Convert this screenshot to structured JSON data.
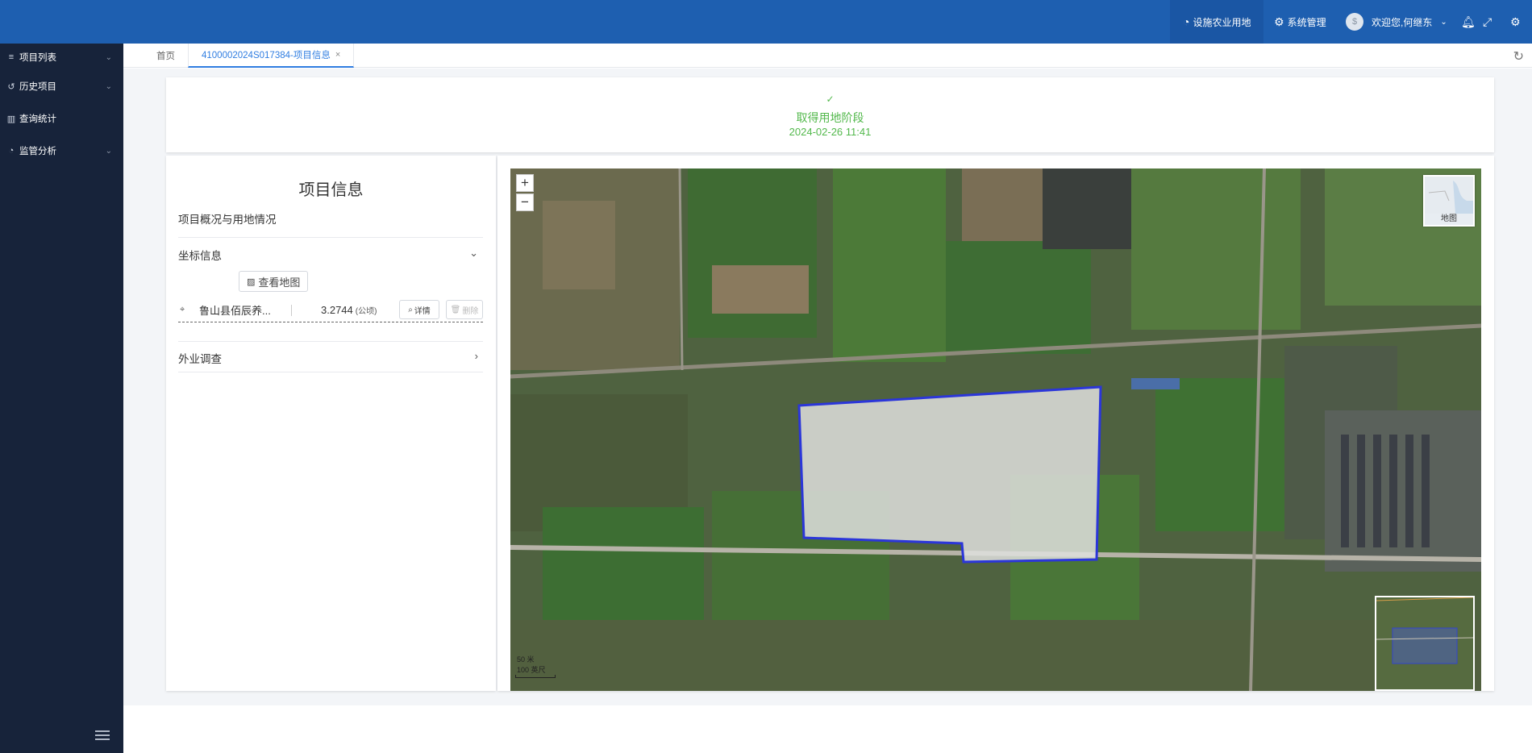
{
  "header": {
    "active_module": "设施农业用地",
    "system_menu": "系统管理",
    "welcome": "欢迎您,何继东",
    "avatar_text": "$"
  },
  "sidebar": {
    "items": [
      {
        "label": "项目列表",
        "icon": "list-icon",
        "expandable": true
      },
      {
        "label": "历史项目",
        "icon": "history-icon",
        "expandable": true
      },
      {
        "label": "查询统计",
        "icon": "chart-icon",
        "expandable": false
      },
      {
        "label": "监管分析",
        "icon": "pie-icon",
        "expandable": true
      }
    ]
  },
  "tabs": {
    "home": "首页",
    "active": "4100002024S017384-项目信息",
    "close": "×"
  },
  "stage": {
    "check": "✓",
    "title": "取得用地阶段",
    "time": "2024-02-26 11:41"
  },
  "info": {
    "title": "项目信息",
    "section_overview": "项目概况与用地情况",
    "section_coords": "坐标信息",
    "view_map_label": "查看地图",
    "coord_item": {
      "name": "鲁山县佰辰养...",
      "area": "3.2744",
      "unit": "(公顷)",
      "detail_label": "详情",
      "delete_label": "删除"
    },
    "section_field": "外业调查"
  },
  "map": {
    "zoom_in": "+",
    "zoom_out": "−",
    "layer_label": "地图",
    "scale_top": "50 米",
    "scale_bottom": "100 英尺"
  },
  "colors": {
    "header": "#1e5fb0",
    "sidebar": "#17233a",
    "accent": "#2f7de1",
    "success": "#52b84b",
    "parcel_outline": "#2b36d9"
  }
}
